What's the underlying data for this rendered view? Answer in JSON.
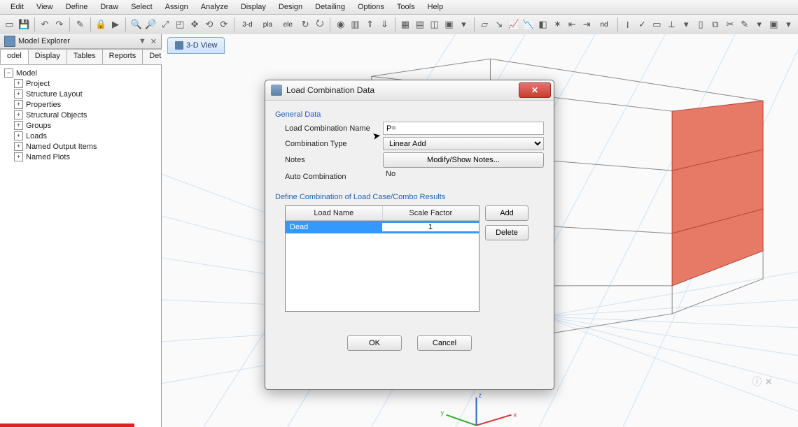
{
  "menu": [
    "Edit",
    "View",
    "Define",
    "Draw",
    "Select",
    "Assign",
    "Analyze",
    "Display",
    "Design",
    "Detailing",
    "Options",
    "Tools",
    "Help"
  ],
  "toolbar_3d_label": "3-d",
  "toolbar_pla_label": "pla",
  "toolbar_ele_label": "ele",
  "toolbar_nd_label": "nd",
  "sidebar": {
    "title": "Model Explorer",
    "tabs": [
      "odel",
      "Display",
      "Tables",
      "Reports",
      "Detailing"
    ],
    "root": "Model",
    "items": [
      "Project",
      "Structure Layout",
      "Properties",
      "Structural Objects",
      "Groups",
      "Loads",
      "Named Output Items",
      "Named Plots"
    ]
  },
  "viewtab": "3-D View",
  "dialog": {
    "title": "Load Combination Data",
    "general_label": "General Data",
    "name_label": "Load Combination Name",
    "name_value": "P=",
    "type_label": "Combination Type",
    "type_value": "Linear Add",
    "notes_label": "Notes",
    "notes_btn": "Modify/Show Notes...",
    "auto_label": "Auto Combination",
    "auto_value": "No",
    "define_label": "Define Combination of Load Case/Combo Results",
    "col_loadname": "Load Name",
    "col_scale": "Scale Factor",
    "rows": [
      {
        "name": "Dead",
        "scale": "1"
      }
    ],
    "btn_add": "Add",
    "btn_delete": "Delete",
    "btn_ok": "OK",
    "btn_cancel": "Cancel"
  }
}
